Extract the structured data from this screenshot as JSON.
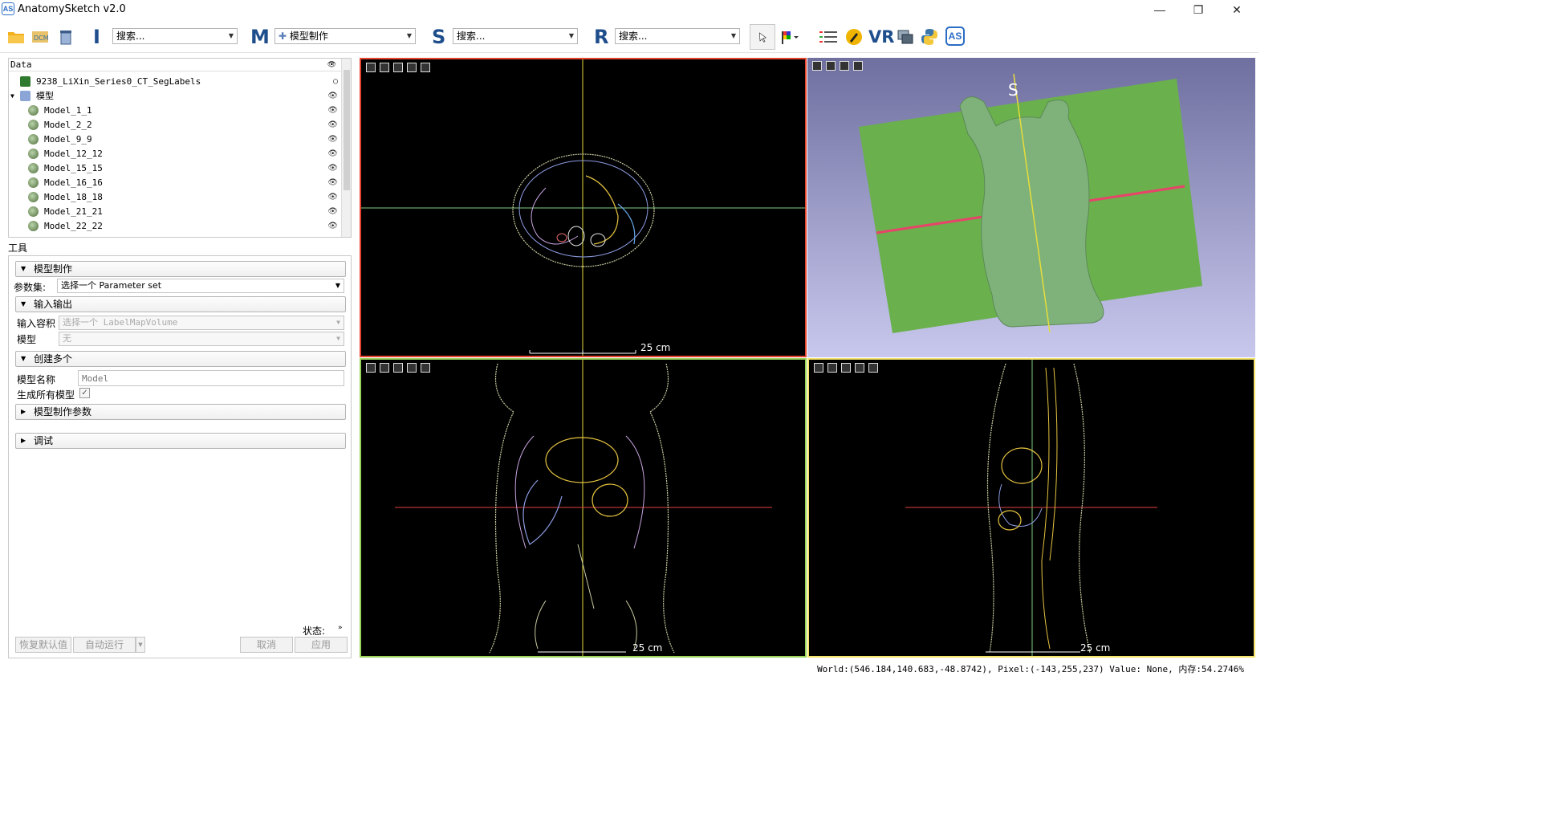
{
  "window": {
    "title": "AnatomySketch v2.0",
    "icon_text": "AS",
    "minimize": "—",
    "restore": "❐",
    "close": "✕"
  },
  "toolbar": {
    "letters": [
      "I",
      "M",
      "S",
      "R"
    ],
    "search_i": "搜索...",
    "module_m": "模型制作",
    "search_s": "搜索...",
    "search_r": "搜索...",
    "vr_label": "VR",
    "as_label": "AS"
  },
  "data_tree": {
    "header": "Data",
    "root": "9238_LiXin_Series0_CT_SegLabels",
    "group": "模型",
    "items": [
      "Model_1_1",
      "Model_2_2",
      "Model_9_9",
      "Model_12_12",
      "Model_15_15",
      "Model_16_16",
      "Model_18_18",
      "Model_21_21",
      "Model_22_22"
    ]
  },
  "tools": {
    "label": "工具",
    "section_model": "模型制作",
    "param_label": "参数集:",
    "param_value": "选择一个 Parameter set",
    "section_io": "输入输出",
    "input_volume_label": "输入容积",
    "input_volume_value": "选择一个 LabelMapVolume",
    "model_label": "模型",
    "model_value": "无",
    "section_create": "创建多个",
    "model_name_label": "模型名称",
    "model_name_placeholder": "Model",
    "generate_all_label": "生成所有模型",
    "generate_all_check": "✓",
    "section_params": "模型制作参数",
    "section_debug": "调试",
    "status_label": "状态:",
    "btn_restore": "恢复默认值",
    "btn_auto": "自动运行",
    "btn_cancel": "取消",
    "btn_apply": "应用"
  },
  "views": {
    "axial_scale": "25 cm",
    "coronal_scale": "25 cm",
    "sagittal_scale": "25 cm",
    "orientation_label": "S"
  },
  "colors": {
    "axial_border": "#e8432f",
    "coronal_border": "#9ad35b",
    "sagittal_border": "#f3e36a",
    "plane": "#6ab04c",
    "model": "#7fb27a"
  },
  "status": {
    "text": "World:(546.184,140.683,-48.8742), Pixel:(-143,255,237) Value: None, 内存:54.2746%"
  }
}
